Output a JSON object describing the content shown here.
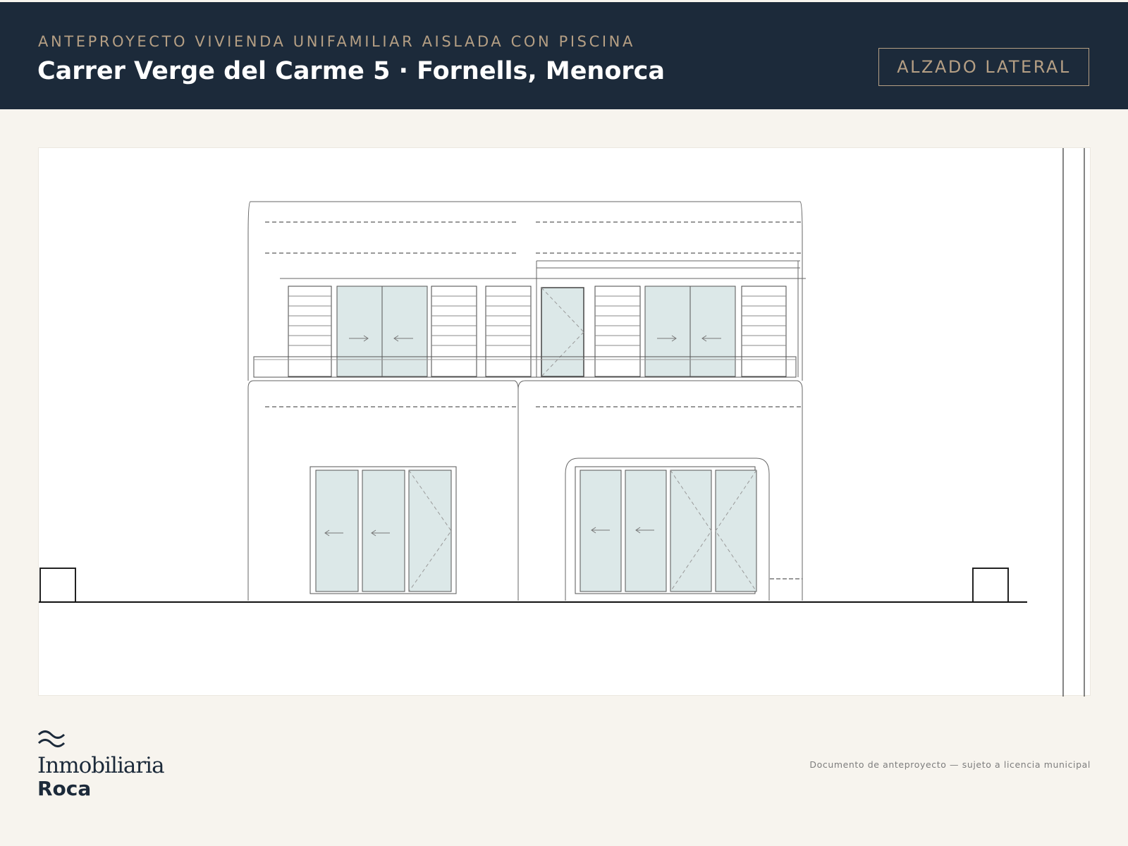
{
  "header": {
    "kicker": "ANTEPROYECTO VIVIENDA UNIFAMILIAR AISLADA CON PISCINA",
    "title": "Carrer Verge del Carme 5 · Fornells, Menorca",
    "tag": "ALZADO LATERAL"
  },
  "drawing": {
    "glass_color": "#dce8e8",
    "line_color": "#555555"
  },
  "brand": {
    "word1": "Inmobiliaria",
    "word2": "Roca",
    "icon": "waves-icon"
  },
  "footer": {
    "note": "Documento de anteproyecto — sujeto a licencia municipal"
  },
  "colors": {
    "header_bg": "#1c2a3a",
    "accent": "#b59f84",
    "page_bg": "#f7f4ee"
  }
}
